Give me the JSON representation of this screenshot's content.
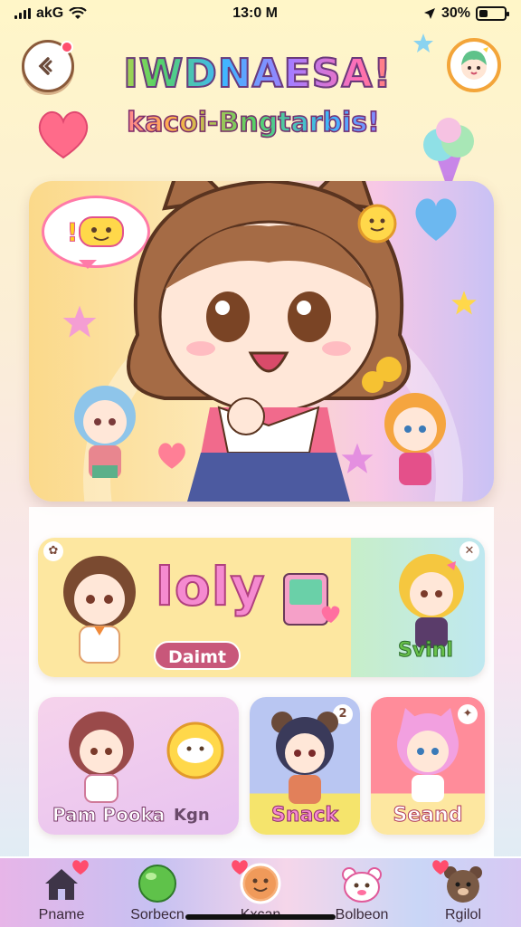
{
  "status_bar": {
    "carrier": "akG",
    "time": "13:0 M",
    "battery": "30%",
    "battery_level": 0.3
  },
  "header": {
    "title": "IWDNAESA!",
    "subtitle": "kacoi-Bngtarbis!"
  },
  "hero": {
    "speech_text": "!"
  },
  "featured_card": {
    "logo_text": "loly",
    "left_label": "Daimt",
    "right_label": "Svinl"
  },
  "cards": [
    {
      "label_primary": "Pam Pooka",
      "label_secondary": "Kgn",
      "color": "#f3c2e4"
    },
    {
      "label": "Snack",
      "color": "#f5e46c"
    },
    {
      "label": "Seand",
      "color": "#ff8c9a"
    }
  ],
  "nav": {
    "items": [
      {
        "label": "Pname"
      },
      {
        "label": "Sorbecn"
      },
      {
        "label": "Kxcan"
      },
      {
        "label": "Bolbeon"
      },
      {
        "label": "Rgilol"
      }
    ]
  },
  "colors": {
    "accent_pink": "#ff6fb5",
    "accent_orange": "#f3a53a",
    "badge_red": "#ff4d6d"
  }
}
